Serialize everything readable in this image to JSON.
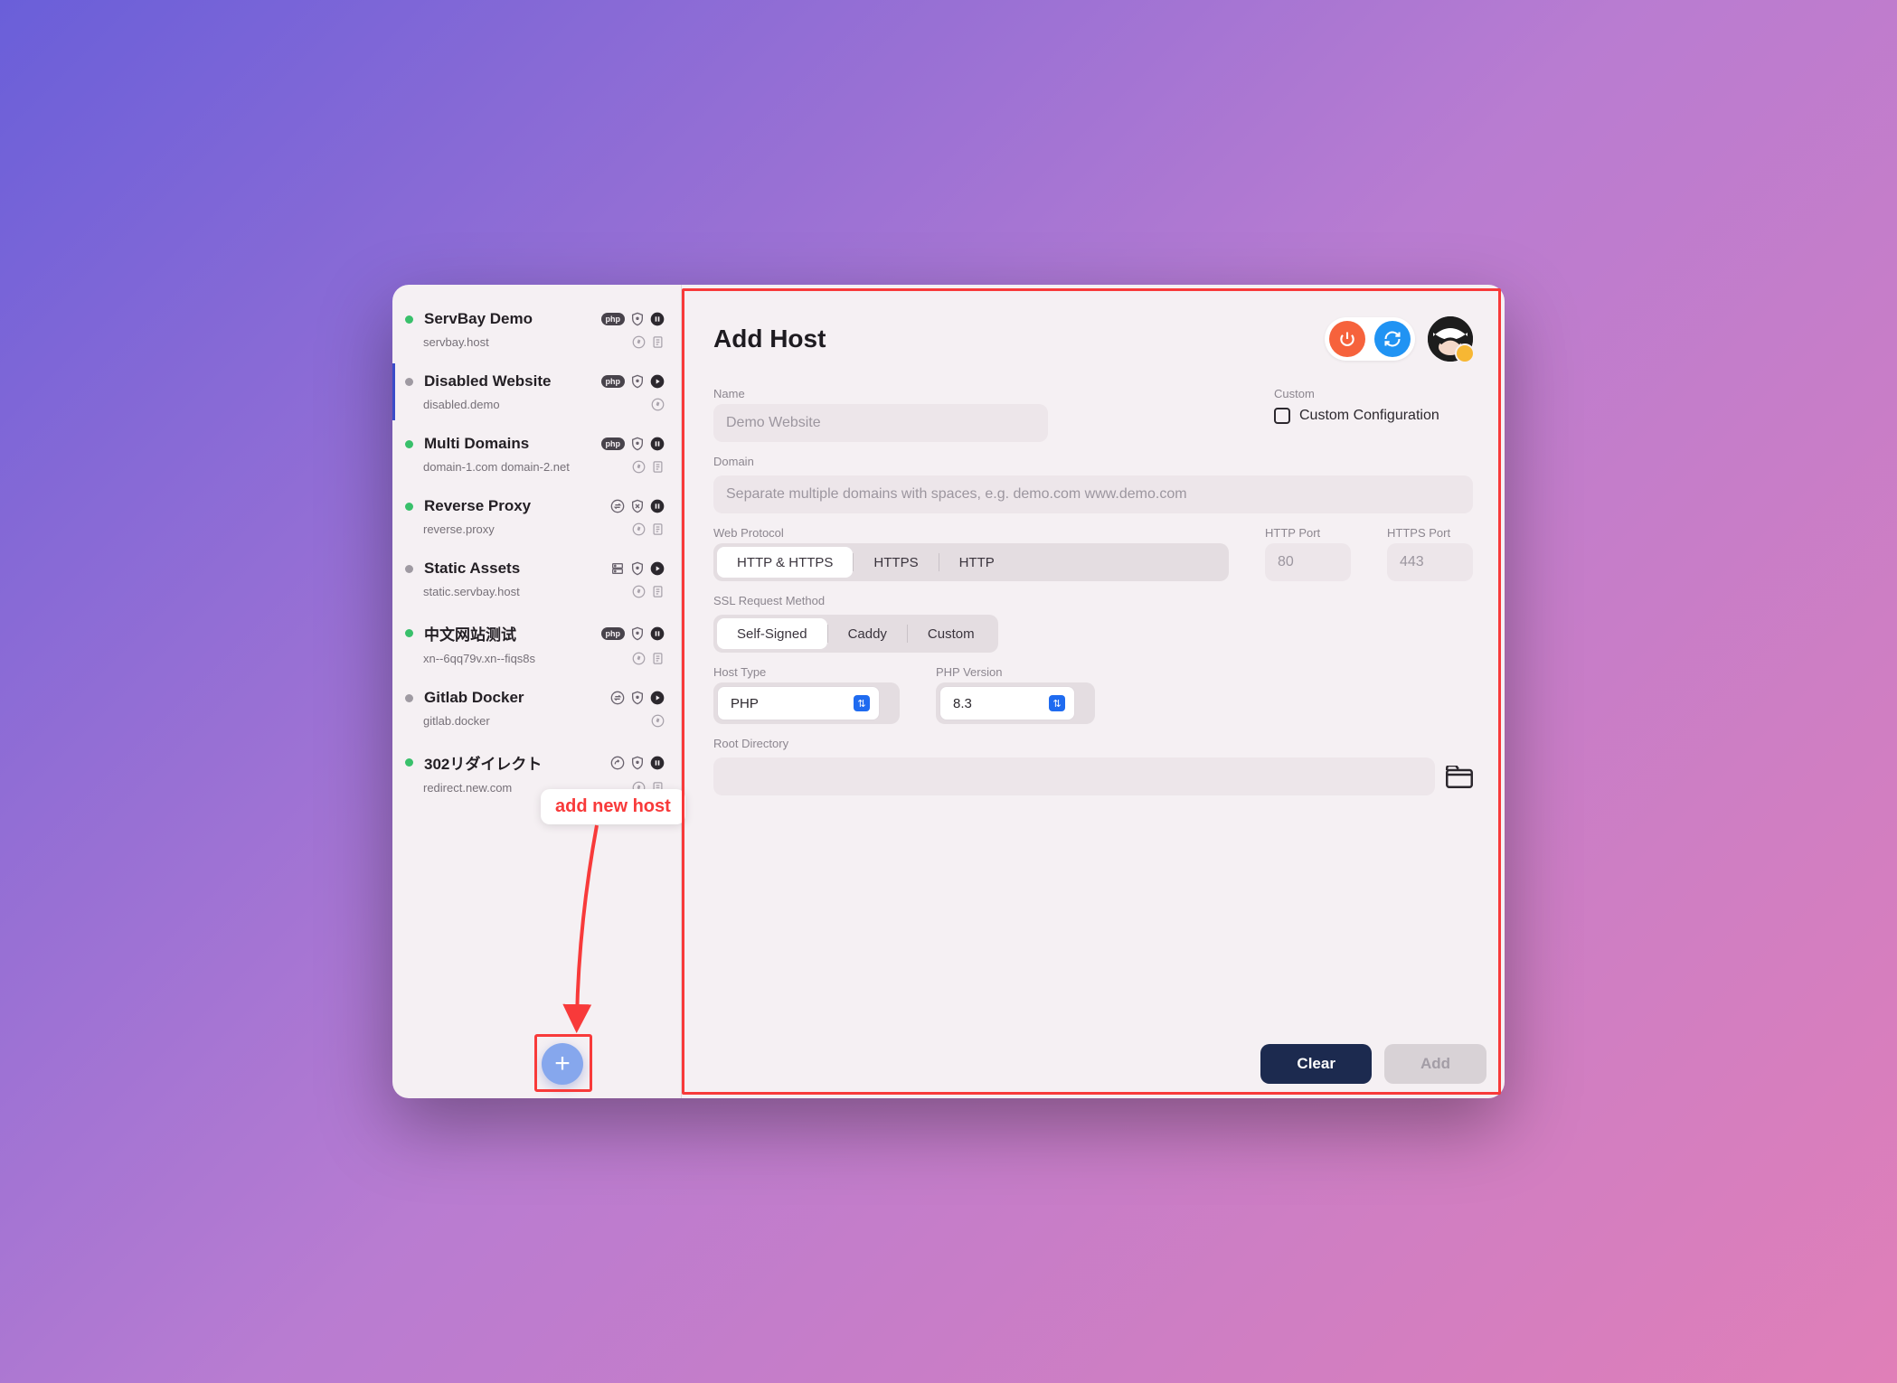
{
  "sidebar": {
    "sites": [
      {
        "name": "ServBay Demo",
        "domain": "servbay.host",
        "status": "green",
        "badge": "php",
        "icon3": "pause",
        "subIconB": "doc"
      },
      {
        "name": "Disabled Website",
        "domain": "disabled.demo",
        "status": "grey",
        "badge": "php",
        "icon3": "play",
        "subIconB": ""
      },
      {
        "name": "Multi Domains",
        "domain": "domain-1.com domain-2.net",
        "status": "green",
        "badge": "php",
        "icon3": "pause",
        "subIconB": "doc"
      },
      {
        "name": "Reverse Proxy",
        "domain": "reverse.proxy",
        "status": "green",
        "badge": "swap",
        "icon3": "pause",
        "subIconB": "doc",
        "shield": "x"
      },
      {
        "name": "Static Assets",
        "domain": "static.servbay.host",
        "status": "grey",
        "badge": "server",
        "icon3": "play",
        "subIconB": "doc"
      },
      {
        "name": "中文网站测试",
        "domain": "xn--6qq79v.xn--fiqs8s",
        "status": "green",
        "badge": "php",
        "icon3": "pause",
        "subIconB": "doc"
      },
      {
        "name": "Gitlab Docker",
        "domain": "gitlab.docker",
        "status": "grey",
        "badge": "swap",
        "icon3": "play",
        "subIconB": ""
      },
      {
        "name": "302リダイレクト",
        "domain": "redirect.new.com",
        "status": "green",
        "badge": "redir",
        "icon3": "pause",
        "subIconB": "doc"
      }
    ],
    "selected_index": 1
  },
  "annotation": {
    "callout": "add new host"
  },
  "header": {
    "title": "Add Host"
  },
  "form": {
    "name_label": "Name",
    "name_placeholder": "Demo Website",
    "custom_label": "Custom",
    "custom_config_label": "Custom Configuration",
    "domain_label": "Domain",
    "domain_placeholder": "Separate multiple domains with spaces, e.g. demo.com www.demo.com",
    "protocol_label": "Web Protocol",
    "protocol_options": [
      "HTTP & HTTPS",
      "HTTPS",
      "HTTP"
    ],
    "protocol_active": 0,
    "http_port_label": "HTTP Port",
    "http_port_placeholder": "80",
    "https_port_label": "HTTPS Port",
    "https_port_placeholder": "443",
    "ssl_label": "SSL Request Method",
    "ssl_options": [
      "Self-Signed",
      "Caddy",
      "Custom"
    ],
    "ssl_active": 0,
    "host_type_label": "Host Type",
    "host_type_value": "PHP",
    "php_version_label": "PHP Version",
    "php_version_value": "8.3",
    "root_dir_label": "Root Directory"
  },
  "footer": {
    "clear": "Clear",
    "add": "Add"
  }
}
